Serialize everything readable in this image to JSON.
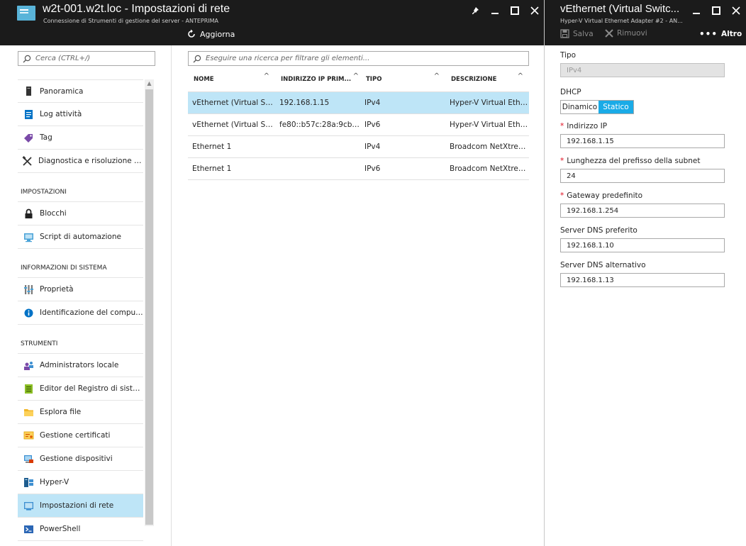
{
  "colors": {
    "header_bg": "#1b1b1b",
    "selection_bg": "#bee5f7",
    "accent": "#1aabe7",
    "required": "#e00b1c"
  },
  "main_blade": {
    "title": "w2t-001.w2t.loc - Impostazioni di rete",
    "subtitle": "Connessione di Strumenti di gestione del server - ANTEPRIMA",
    "refresh_label": "Aggiorna"
  },
  "nav": {
    "search_placeholder": "Cerca (CTRL+/)",
    "items_top": [
      {
        "label": "Panoramica",
        "icon": "server-icon"
      },
      {
        "label": "Log attività",
        "icon": "activity-log-icon"
      },
      {
        "label": "Tag",
        "icon": "tag-icon"
      },
      {
        "label": "Diagnostica e risoluzione dei...",
        "icon": "tools-icon"
      }
    ],
    "section_settings": "IMPOSTAZIONI",
    "items_settings": [
      {
        "label": "Blocchi",
        "icon": "lock-icon"
      },
      {
        "label": "Script di automazione",
        "icon": "script-icon"
      }
    ],
    "section_sysinfo": "INFORMAZIONI DI SISTEMA",
    "items_sysinfo": [
      {
        "label": "Proprietà",
        "icon": "properties-icon"
      },
      {
        "label": "Identificazione del computer",
        "icon": "info-icon"
      }
    ],
    "section_tools": "STRUMENTI",
    "items_tools": [
      {
        "label": "Administrators locale",
        "icon": "users-icon"
      },
      {
        "label": "Editor del Registro di sistema",
        "icon": "registry-icon"
      },
      {
        "label": "Esplora file",
        "icon": "folder-icon"
      },
      {
        "label": "Gestione certificati",
        "icon": "certificate-icon"
      },
      {
        "label": "Gestione dispositivi",
        "icon": "devices-icon"
      },
      {
        "label": "Hyper-V",
        "icon": "hyperv-icon"
      },
      {
        "label": "Impostazioni di rete",
        "icon": "network-icon"
      },
      {
        "label": "PowerShell",
        "icon": "powershell-icon"
      }
    ]
  },
  "grid": {
    "search_placeholder": "Eseguire una ricerca per filtrare gli elementi...",
    "columns": [
      "NOME",
      "INDIRIZZO IP PRIM...",
      "TIPO",
      "DESCRIZIONE"
    ],
    "rows": [
      [
        "vEthernet (Virtual Sw...",
        "192.168.1.15",
        "IPv4",
        "Hyper-V Virtual Ethe..."
      ],
      [
        "vEthernet (Virtual Sw...",
        "fe80::b57c:28a:9cbe:...",
        "IPv6",
        "Hyper-V Virtual Ethe..."
      ],
      [
        "Ethernet 1",
        "",
        "IPv4",
        "Broadcom NetXtrem..."
      ],
      [
        "Ethernet 1",
        "",
        "IPv6",
        "Broadcom NetXtrem..."
      ]
    ]
  },
  "side_blade": {
    "title": "vEthernet (Virtual Switc...",
    "subtitle": "Hyper-V Virtual Ethernet Adapter #2 - AN...",
    "save_label": "Salva",
    "remove_label": "Rimuovi",
    "more_label": "Altro",
    "type_label": "Tipo",
    "type_value": "IPv4",
    "dhcp_label": "DHCP",
    "dhcp_dynamic": "Dinamico",
    "dhcp_static": "Statico",
    "ip_label": "Indirizzo IP",
    "ip_value": "192.168.1.15",
    "prefix_label": "Lunghezza del prefisso della subnet",
    "prefix_value": "24",
    "gateway_label": "Gateway predefinito",
    "gateway_value": "192.168.1.254",
    "dns1_label": "Server DNS preferito",
    "dns1_value": "192.168.1.10",
    "dns2_label": "Server DNS alternativo",
    "dns2_value": "192.168.1.13"
  }
}
